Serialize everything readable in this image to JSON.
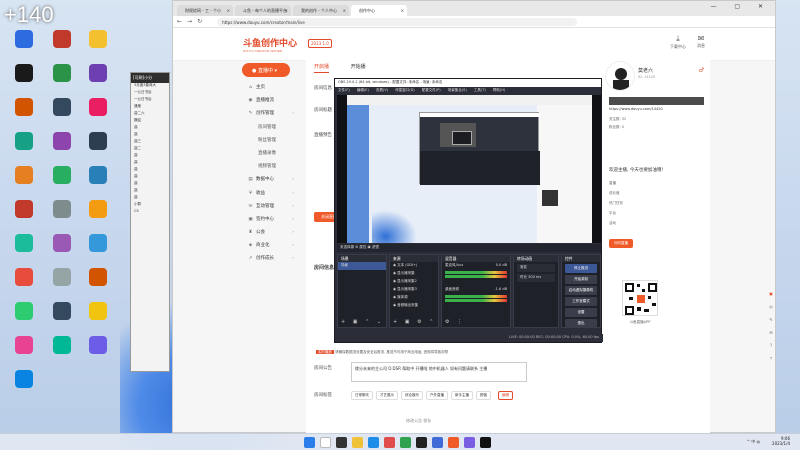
{
  "desktop": {
    "counter": "+140",
    "icons": [
      "",
      "",
      "",
      "",
      "",
      "",
      "",
      "",
      "",
      "",
      "",
      "",
      "",
      "",
      "",
      "",
      "",
      "",
      "",
      "",
      "",
      "",
      "",
      "",
      "",
      "",
      "",
      "",
      "",
      "",
      ""
    ]
  },
  "chat_window": {
    "title": "[可刷]小分",
    "rows": [
      "3月度3春商大",
      "一公日书谷",
      "一公日书谷",
      "通鬼",
      "曲二六",
      "魏迎",
      "曲",
      "曲",
      "曲三",
      "曲二",
      "曲",
      "曲",
      "曲",
      "曲",
      "曲",
      "曲",
      "曲",
      "小群",
      "CS"
    ]
  },
  "browser": {
    "tabs": [
      {
        "label": "财视综网 - 工 - 个小"
      },
      {
        "label": "斗鱼 - 每个人的直播平台"
      },
      {
        "label": "我的创作 - 个人中心"
      },
      {
        "label": "创作中心"
      }
    ],
    "url": "https://www.douyu.com/creator/main/live",
    "window_controls": "— ▢ ✕"
  },
  "site": {
    "logo_text": "斗鱼创作中心",
    "logo_sub": "DOUYU CREATOR CENTER",
    "logo_badge": "2023 1.0",
    "header_icons": [
      {
        "label": "下载中心",
        "icon": "download-icon"
      },
      {
        "label": "消息",
        "icon": "bell-icon"
      }
    ]
  },
  "sidebar": {
    "live_button": "直播中",
    "items": [
      {
        "label": "主页",
        "sub": false,
        "icon": "home-icon"
      },
      {
        "label": "直播推流",
        "sub": false,
        "icon": "broadcast-icon"
      },
      {
        "label": "创作管理",
        "sub": false,
        "icon": "pen-icon"
      },
      {
        "label": "房间管理",
        "sub": true
      },
      {
        "label": "粉丝管理",
        "sub": true
      },
      {
        "label": "直播录像",
        "sub": true
      },
      {
        "label": "视频管理",
        "sub": true
      },
      {
        "label": "数据中心",
        "sub": false,
        "icon": "chart-icon"
      },
      {
        "label": "收益",
        "sub": false,
        "icon": "money-icon"
      },
      {
        "label": "互动管理",
        "sub": false,
        "icon": "chat-icon"
      },
      {
        "label": "签约中心",
        "sub": false,
        "icon": "contract-icon"
      },
      {
        "label": "公会",
        "sub": false,
        "icon": "guild-icon"
      },
      {
        "label": "商业化",
        "sub": false,
        "icon": "shop-icon"
      },
      {
        "label": "创作成长",
        "sub": false,
        "icon": "growth-icon"
      }
    ]
  },
  "main": {
    "tabs": [
      "开启播",
      "开始播"
    ],
    "labels": [
      "房间信息",
      "房间标题",
      "直播预告",
      "房间信息",
      "房间公告",
      "房间标签"
    ],
    "start_button": "关闭直播",
    "notice_prefix": "实时播放",
    "notice_text": "请确保数据流设置及安全后推流, 推送不可用于商业用途, 违规将导致封禁",
    "announce_text": "缘分未来的主公司 O.DSR 帮助中 开播啦 地中机器人 如有问题请联系 主播",
    "tags": [
      "日常聊天",
      "才艺展示",
      "综合娱乐",
      "户外直播",
      "新手主播",
      "颜值"
    ],
    "tag_edit": "编辑",
    "save": "修改公告   保存"
  },
  "rightpanel": {
    "username": "莫老六",
    "uid": "ID: 14420",
    "profile_link": "https://www.douyu.com/14420",
    "info1": "关注数: 32",
    "info2": "粉丝数: 0",
    "greeting": "欢迎主播, 今天也要加油哦!",
    "lines": [
      "直播",
      "成长值",
      "热门任务",
      "平台",
      "活动"
    ],
    "follow_btn": "问问直播",
    "qr_caption": "斗鱼直播APP"
  },
  "obs": {
    "title": "OBS 29.0.2 (64 bit, windows) - 配置文件: 未命名 - 场景: 未命名",
    "menus": [
      "文件(F)",
      "编辑(E)",
      "查看(V)",
      "停靠窗口(D)",
      "配置文件(P)",
      "场景集合(S)",
      "工具(T)",
      "帮助(H)"
    ],
    "source_bar": "未选择源        ⚙ 属性   ▣ 滤镜",
    "scenes_title": "场景",
    "scenes": [
      "场景"
    ],
    "sources_title": "来源",
    "sources": [
      "文本 (GDI+)",
      "显示器采集",
      "显示器采集2",
      "显示器采集3",
      "媒体源",
      "音频输出采集"
    ],
    "mixer_title": "混音器",
    "mixer": [
      {
        "label": "麦克风/Aux",
        "db": "0.0 dB"
      },
      {
        "label": "桌面音频",
        "db": "-1.6 dB"
      }
    ],
    "transition_title": "转场动画",
    "transition": [
      "渐变",
      "时长 300 ms"
    ],
    "controls_title": "控件",
    "controls": [
      "停止推流",
      "开始录制",
      "启动虚拟摄像机",
      "工作室模式",
      "设置",
      "退出"
    ],
    "status": "LIVE: 00:00:00    REC: 00:00:00    CPU: 0.0%, 60.00 fps"
  },
  "taskbar": {
    "time": "9:06",
    "date": "2023/1/4",
    "tray": "^ 中 ◍"
  }
}
